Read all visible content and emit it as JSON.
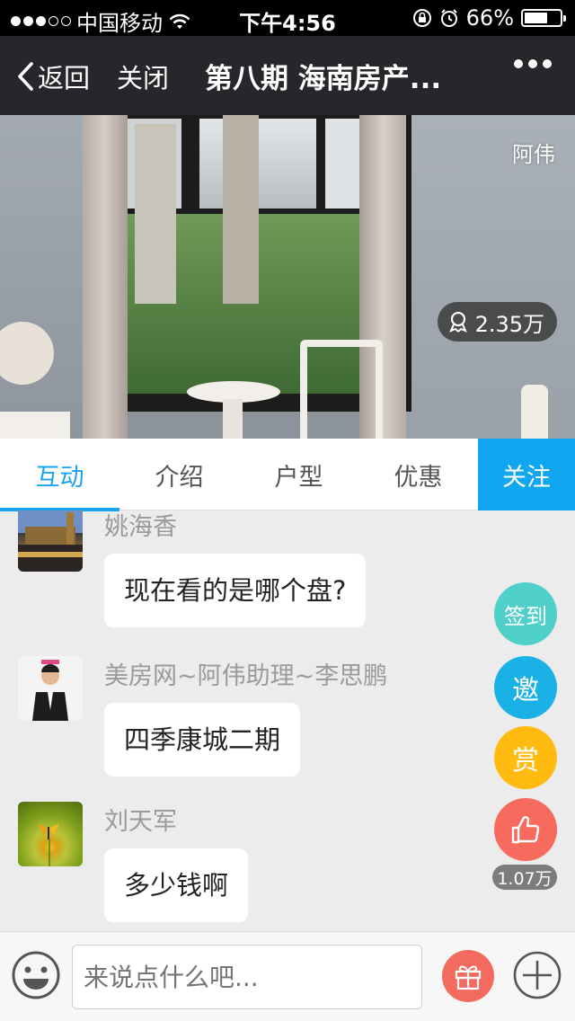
{
  "status_bar": {
    "carrier": "中国移动",
    "time": "下午4:56",
    "battery_percent": "66%",
    "battery_level": 0.66,
    "signal_dots": 3,
    "signal_total": 5
  },
  "nav": {
    "back_label": "返回",
    "close_label": "关闭",
    "title": "第八期 海南房产..."
  },
  "video": {
    "host_name": "阿伟",
    "viewer_count": "2.35万"
  },
  "tabs": {
    "items": [
      "互动",
      "介绍",
      "户型",
      "优惠"
    ],
    "active_index": 0,
    "follow_label": "关注"
  },
  "chat": {
    "messages": [
      {
        "user": "姚海香",
        "text": "现在看的是哪个盘?"
      },
      {
        "user": "美房网~阿伟助理~李思鹏",
        "text": "四季康城二期"
      },
      {
        "user": "刘天军",
        "text": "多少钱啊"
      }
    ]
  },
  "side_actions": {
    "sign_in": "签到",
    "invite": "邀",
    "reward": "赏",
    "like_count": "1.07万"
  },
  "input": {
    "placeholder": "来说点什么吧..."
  },
  "colors": {
    "accent": "#1aa3f0",
    "follow_bg": "#10a6f0",
    "sign_in": "#4fd0c8",
    "invite": "#1ab1e7",
    "reward": "#ffbb10",
    "like": "#f76b5e",
    "gift": "#f36a5f"
  }
}
